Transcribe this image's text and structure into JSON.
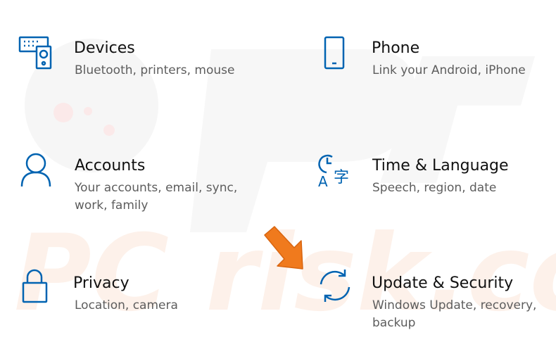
{
  "settings": {
    "devices": {
      "title": "Devices",
      "desc": "Bluetooth, printers, mouse",
      "icon": "keyboard-speaker-icon"
    },
    "phone": {
      "title": "Phone",
      "desc": "Link your Android, iPhone",
      "icon": "phone-icon"
    },
    "accounts": {
      "title": "Accounts",
      "desc": "Your accounts, email, sync, work, family",
      "icon": "person-icon"
    },
    "time": {
      "title": "Time & Language",
      "desc": "Speech, region, date",
      "icon": "time-language-icon"
    },
    "privacy": {
      "title": "Privacy",
      "desc": "Location, camera",
      "icon": "lock-icon"
    },
    "update": {
      "title": "Update & Security",
      "desc": "Windows Update, recovery, backup",
      "icon": "sync-icon"
    }
  },
  "watermark": {
    "text": "PC risk.com"
  },
  "colors": {
    "accent": "#0063b1",
    "arrow": "#f07a1d",
    "title": "#111111",
    "desc": "#5d5d5d",
    "watermark": "#f6f6f6"
  },
  "annotation": {
    "icon": "orange-arrow-icon"
  }
}
